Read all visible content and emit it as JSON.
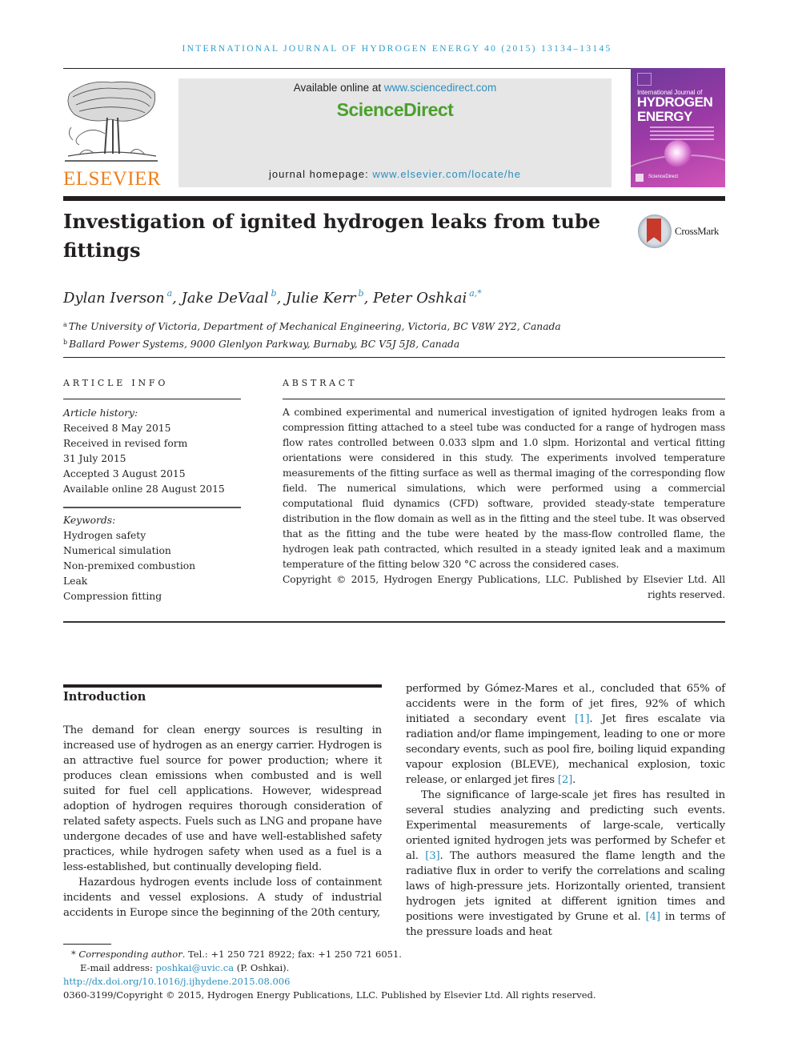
{
  "journal_header": "INTERNATIONAL JOURNAL OF HYDROGEN ENERGY 40 (2015) 13134–13145",
  "publisher": {
    "logo_word": "ELSEVIER",
    "logo_icon": "tree-icon"
  },
  "sciencedirect": {
    "available_prefix": "Available online at ",
    "available_link": "www.sciencedirect.com",
    "brand": "ScienceDirect",
    "homepage_prefix": "journal homepage: ",
    "homepage_link": "www.elsevier.com/locate/he",
    "brand_color": "#4aa02c",
    "link_color": "#2a8fbd"
  },
  "cover": {
    "line1": "International Journal of",
    "line2": "HYDROGEN",
    "line3": "ENERGY",
    "footer": "ScienceDirect"
  },
  "article": {
    "title": "Investigation of ignited hydrogen leaks from tube fittings",
    "crossmark_label": "CrossMark",
    "authors": [
      {
        "name": "Dylan Iverson",
        "sup": "a"
      },
      {
        "name": "Jake DeVaal",
        "sup": "b"
      },
      {
        "name": "Julie Kerr",
        "sup": "b"
      },
      {
        "name": "Peter Oshkai",
        "sup": "a,*"
      }
    ],
    "affiliations": [
      {
        "mark": "a",
        "text": "The University of Victoria, Department of Mechanical Engineering, Victoria, BC V8W 2Y2, Canada"
      },
      {
        "mark": "b",
        "text": "Ballard Power Systems, 9000 Glenlyon Parkway, Burnaby, BC V5J 5J8, Canada"
      }
    ]
  },
  "article_info": {
    "heading": "ARTICLE INFO",
    "history_label": "Article history:",
    "history": [
      "Received 8 May 2015",
      "Received in revised form",
      "31 July 2015",
      "Accepted 3 August 2015",
      "Available online 28 August 2015"
    ],
    "keywords_label": "Keywords:",
    "keywords": [
      "Hydrogen safety",
      "Numerical simulation",
      "Non-premixed combustion",
      "Leak",
      "Compression fitting"
    ]
  },
  "abstract": {
    "heading": "ABSTRACT",
    "text": "A combined experimental and numerical investigation of ignited hydrogen leaks from a compression fitting attached to a steel tube was conducted for a range of hydrogen mass flow rates controlled between 0.033 slpm and 1.0 slpm. Horizontal and vertical fitting orientations were considered in this study. The experiments involved temperature measurements of the fitting surface as well as thermal imaging of the corresponding flow field. The numerical simulations, which were performed using a commercial computational fluid dynamics (CFD) software, provided steady-state temperature distribution in the flow domain as well as in the fitting and the steel tube. It was observed that as the fitting and the tube were heated by the mass-flow controlled flame, the hydrogen leak path contracted, which resulted in a steady ignited leak and a maximum temperature of the fitting below 320 °C across the considered cases.",
    "copyright": "Copyright © 2015, Hydrogen Energy Publications, LLC. Published by Elsevier Ltd. All rights reserved."
  },
  "introduction": {
    "heading": "Introduction",
    "left_p1": "The demand for clean energy sources is resulting in increased use of hydrogen as an energy carrier. Hydrogen is an attractive fuel source for power production; where it produces clean emissions when combusted and is well suited for fuel cell applications. However, widespread adoption of hydrogen requires thorough consideration of related safety aspects. Fuels such as LNG and propane have undergone decades of use and have well-established safety practices, while hydrogen safety when used as a fuel is a less-established, but continually developing field.",
    "left_p2": "Hazardous hydrogen events include loss of containment incidents and vessel explosions. A study of industrial accidents in Europe since the beginning of the 20th century,",
    "right_p1": {
      "t1": "performed by Gómez-Mares et al., concluded that 65% of accidents were in the form of jet fires, 92% of which initiated a secondary event ",
      "r1": "[1]",
      "t2": ". Jet fires escalate via radiation and/or flame impingement, leading to one or more secondary events, such as pool fire, boiling liquid expanding vapour explosion (BLEVE), mechanical explosion, toxic release, or enlarged jet fires ",
      "r2": "[2]",
      "t3": "."
    },
    "right_p2": {
      "t1": "The significance of large-scale jet fires has resulted in several studies analyzing and predicting such events. Experimental measurements of large-scale, vertically oriented ignited hydrogen jets was performed by Schefer et al. ",
      "r3": "[3]",
      "t2": ". The authors measured the flame length and the radiative flux in order to verify the correlations and scaling laws of high-pressure jets. Horizontally oriented, transient hydrogen jets ignited at different ignition times and positions were investigated by Grune et al. ",
      "r4": "[4]",
      "t3": " in terms of the pressure loads and heat"
    }
  },
  "footnotes": {
    "star": "*",
    "corresponding_label": "Corresponding author",
    "contact": ". Tel.: +1 250 721 8922; fax: +1 250 721 6051.",
    "email_prefix": "E-mail address: ",
    "email": "poshkai@uvic.ca",
    "email_suffix": " (P. Oshkai).",
    "doi": "http://dx.doi.org/10.1016/j.ijhydene.2015.08.006",
    "issn_copyright": "0360-3199/Copyright © 2015, Hydrogen Energy Publications, LLC. Published by Elsevier Ltd. All rights reserved."
  }
}
